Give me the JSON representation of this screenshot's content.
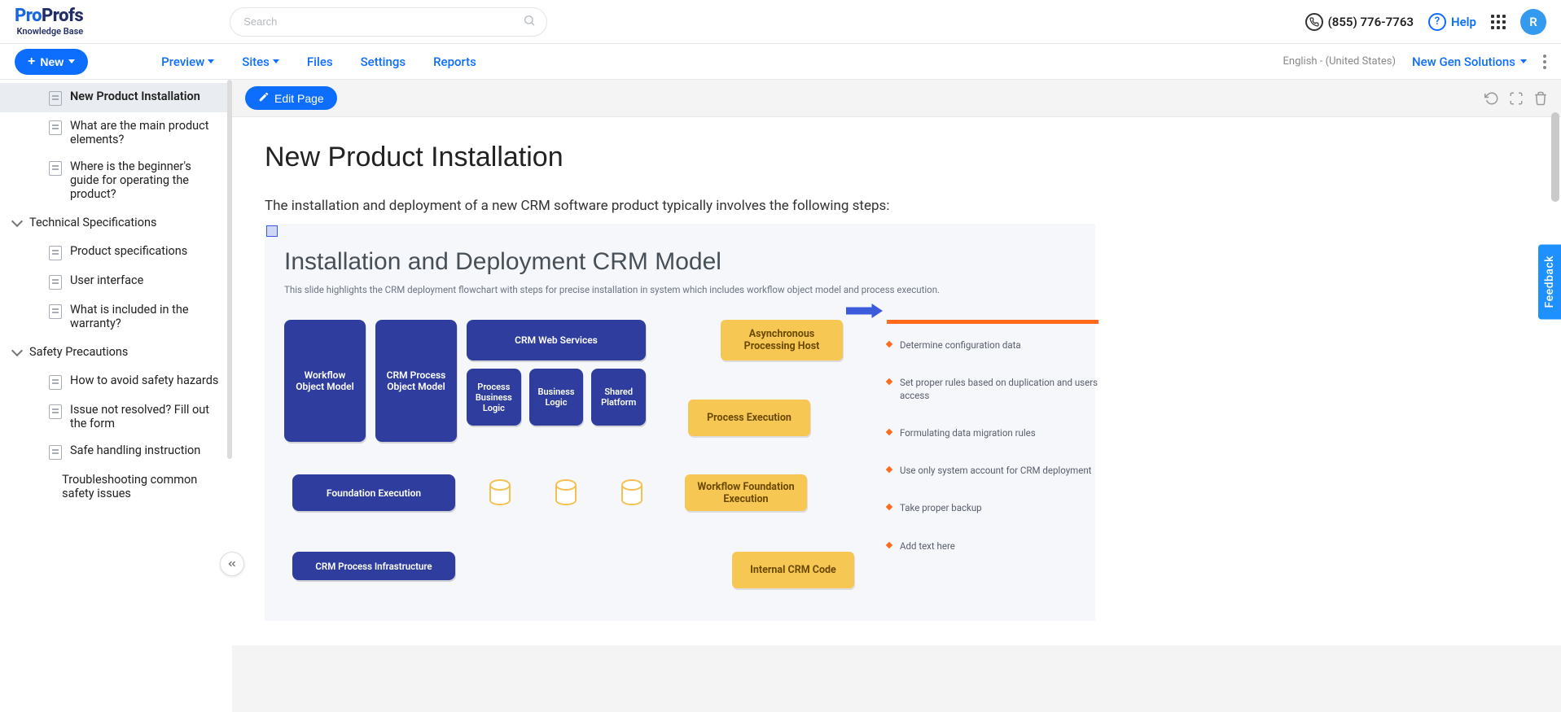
{
  "brand": {
    "pro": "Pro",
    "profs": "Profs",
    "sub": "Knowledge Base"
  },
  "search": {
    "placeholder": "Search"
  },
  "header": {
    "phone": "(855) 776-7763",
    "help": "Help",
    "avatar": "R"
  },
  "toolbar": {
    "new_label": "New",
    "menu": {
      "preview": "Preview",
      "sites": "Sites",
      "files": "Files",
      "settings": "Settings",
      "reports": "Reports"
    },
    "language": "English - (United States)",
    "solution": "New Gen Solutions"
  },
  "sidebar": {
    "items": [
      {
        "label": "New Product Installation"
      },
      {
        "label": "What are the main product elements?"
      },
      {
        "label": "Where is the beginner's guide for operating the product?"
      }
    ],
    "section_tech": "Technical Specifications",
    "tech_items": [
      {
        "label": "Product specifications"
      },
      {
        "label": "User interface"
      },
      {
        "label": "What is included in the warranty?"
      }
    ],
    "section_safety": "Safety Precautions",
    "safety_items": [
      {
        "label": "How to avoid safety hazards"
      },
      {
        "label": "Issue not resolved? Fill out the form"
      },
      {
        "label": "Safe handling instruction"
      },
      {
        "label": "Troubleshooting common safety issues"
      }
    ]
  },
  "content": {
    "edit_label": "Edit Page",
    "title": "New Product Installation",
    "intro": "The installation and deployment of a new CRM software product typically involves the following steps:",
    "figure": {
      "title": "Installation and Deployment CRM Model",
      "subtitle": "This slide highlights the CRM deployment flowchart with steps for precise installation in system which includes workflow object model and process execution.",
      "boxes": {
        "workflow": "Workflow Object Model",
        "crmproc": "CRM Process Object Model",
        "webserv": "CRM Web Services",
        "pbl": "Process Business Logic",
        "bl": "Business Logic",
        "sp": "Shared Platform",
        "async": "Asynchronous Processing Host",
        "procexec": "Process Execution",
        "found": "Foundation Execution",
        "wfe": "Workflow Foundation Execution",
        "infra": "CRM Process Infrastructure",
        "intcode": "Internal CRM Code"
      },
      "bullets": [
        "Determine configuration data",
        "Set proper rules based on duplication and users access",
        "Formulating data migration rules",
        "Use only system account for CRM deployment",
        "Take proper backup",
        "Add text here"
      ]
    }
  },
  "feedback": "Feedback"
}
